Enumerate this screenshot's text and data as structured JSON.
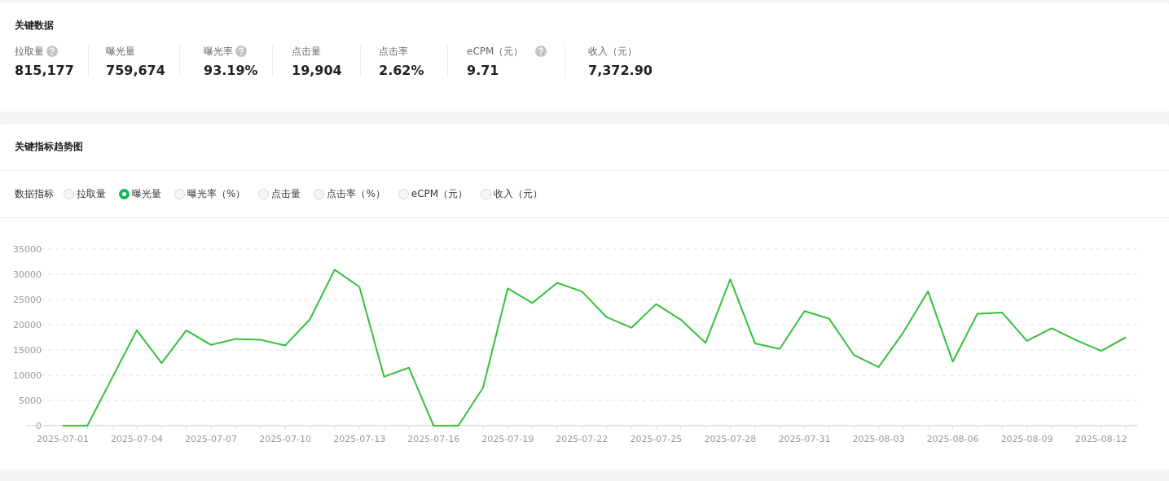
{
  "key_data": {
    "title": "关键数据",
    "metrics": [
      {
        "label": "拉取量",
        "help": true,
        "value": "815,177"
      },
      {
        "label": "曝光量",
        "help": false,
        "value": "759,674"
      },
      {
        "label": "曝光率",
        "help": true,
        "value": "93.19%"
      },
      {
        "label": "点击量",
        "help": false,
        "value": "19,904"
      },
      {
        "label": "点击率",
        "help": false,
        "value": "2.62%"
      },
      {
        "label": "eCPM（元）",
        "help": true,
        "value": "9.71"
      },
      {
        "label": "收入（元）",
        "help": false,
        "value": "7,372.90"
      }
    ]
  },
  "trend": {
    "title": "关键指标趋势图",
    "indicator_label": "数据指标",
    "options": [
      {
        "label": "拉取量",
        "selected": false
      },
      {
        "label": "曝光量",
        "selected": true
      },
      {
        "label": "曝光率（%）",
        "selected": false
      },
      {
        "label": "点击量",
        "selected": false
      },
      {
        "label": "点击率（%）",
        "selected": false
      },
      {
        "label": "eCPM（元）",
        "selected": false
      },
      {
        "label": "收入（元）",
        "selected": false
      }
    ],
    "chart_data": {
      "type": "line",
      "grid": true,
      "ylim": [
        0,
        35000
      ],
      "yticks": [
        0,
        5000,
        10000,
        15000,
        20000,
        25000,
        30000,
        35000
      ],
      "categories": [
        "2025-07-01",
        null,
        null,
        "2025-07-04",
        null,
        null,
        "2025-07-07",
        null,
        null,
        "2025-07-10",
        null,
        null,
        "2025-07-13",
        null,
        null,
        "2025-07-16",
        null,
        null,
        "2025-07-19",
        null,
        null,
        "2025-07-22",
        null,
        null,
        "2025-07-25",
        null,
        null,
        "2025-07-28",
        null,
        null,
        "2025-07-31",
        null,
        null,
        "2025-08-03",
        null,
        null,
        "2025-08-06",
        null,
        null,
        "2025-08-09",
        null,
        null,
        "2025-08-12",
        null
      ],
      "series": [
        {
          "color": "#33c13a",
          "values": [
            0,
            0,
            9500,
            18900,
            12400,
            18900,
            16000,
            17200,
            17000,
            15900,
            21100,
            30900,
            27500,
            9700,
            11500,
            0,
            0,
            7500,
            27200,
            24300,
            28300,
            26600,
            21500,
            19400,
            24100,
            21000,
            16400,
            29000,
            16300,
            15200,
            22700,
            21200,
            14000,
            11600,
            18500,
            26600,
            12700,
            22200,
            22400,
            16800,
            19300,
            16900,
            14800,
            17500
          ]
        }
      ]
    }
  }
}
